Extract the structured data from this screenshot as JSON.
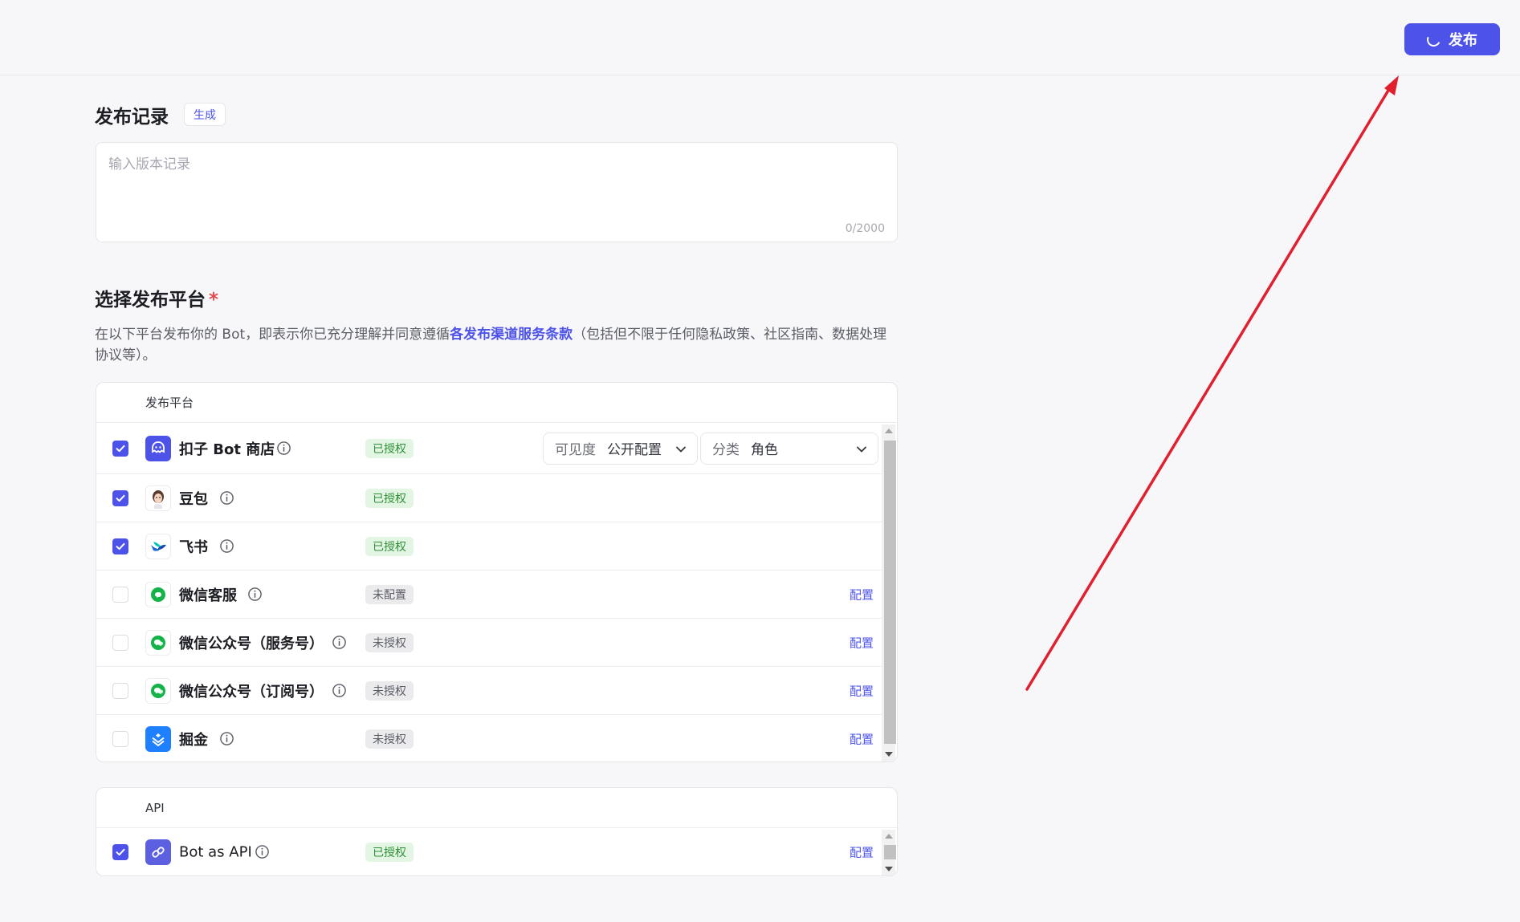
{
  "header": {
    "publish_label": "发布"
  },
  "release_notes": {
    "title": "发布记录",
    "generate_label": "生成",
    "placeholder": "输入版本记录",
    "counter": "0/2000"
  },
  "platforms_section": {
    "title": "选择发布平台",
    "required_mark": "*",
    "desc_before": "在以下平台发布你的 Bot，即表示你已充分理解并同意遵循",
    "desc_link": "各发布渠道服务条款",
    "desc_after": "（包括但不限于任何隐私政策、社区指南、数据处理协议等）。"
  },
  "platform_panel": {
    "header": "发布平台",
    "rows": [
      {
        "name": "扣子 Bot 商店",
        "checked": true,
        "status": "已授权",
        "status_type": "ok",
        "icon": "coze-store-icon",
        "color": "#4d53e8"
      },
      {
        "name": "豆包",
        "checked": true,
        "status": "已授权",
        "status_type": "ok",
        "icon": "doubao-icon",
        "color": "#ffffff"
      },
      {
        "name": "飞书",
        "checked": true,
        "status": "已授权",
        "status_type": "ok",
        "icon": "feishu-icon",
        "color": "#ffffff"
      },
      {
        "name": "微信客服",
        "checked": false,
        "status": "未配置",
        "status_type": "no",
        "icon": "wechat-icon",
        "color": "#ffffff",
        "action": "配置"
      },
      {
        "name": "微信公众号（服务号）",
        "checked": false,
        "status": "未授权",
        "status_type": "no",
        "icon": "wechat-icon",
        "color": "#ffffff",
        "action": "配置"
      },
      {
        "name": "微信公众号（订阅号）",
        "checked": false,
        "status": "未授权",
        "status_type": "no",
        "icon": "wechat-icon",
        "color": "#ffffff",
        "action": "配置"
      },
      {
        "name": "掘金",
        "checked": false,
        "status": "未授权",
        "status_type": "no",
        "icon": "juejin-icon",
        "color": "#1e80ff",
        "action": "配置"
      }
    ],
    "visibility": {
      "label": "可见度",
      "value": "公开配置"
    },
    "category": {
      "label": "分类",
      "value": "角色"
    }
  },
  "api_panel": {
    "header": "API",
    "rows": [
      {
        "name": "Bot as API",
        "checked": true,
        "status": "已授权",
        "status_type": "ok",
        "icon": "api-link-icon",
        "action": "配置"
      }
    ]
  },
  "colors": {
    "accent": "#4d53e8",
    "annotation_arrow": "#e0202f"
  }
}
